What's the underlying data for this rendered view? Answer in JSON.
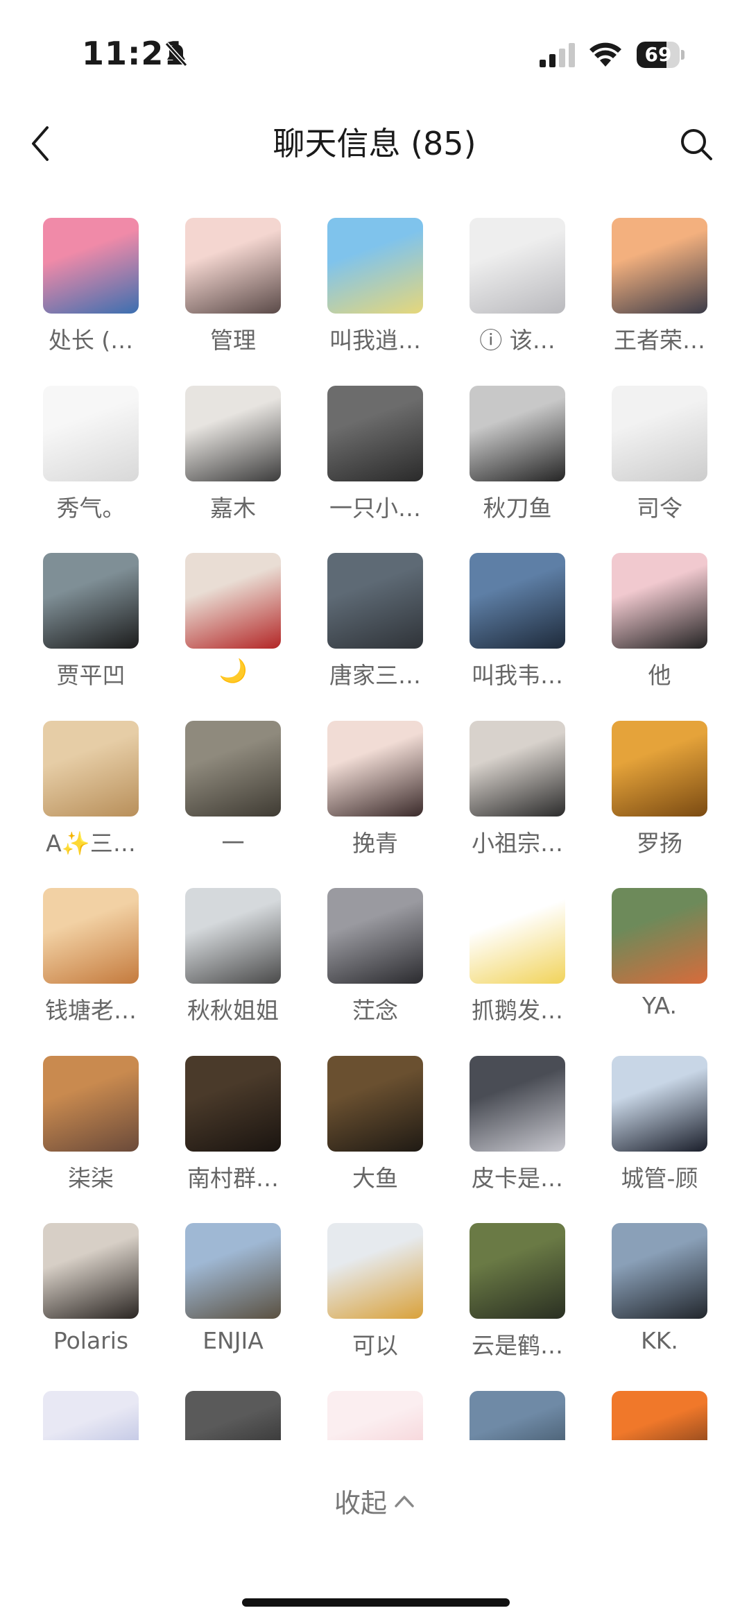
{
  "status_bar": {
    "time": "11:21",
    "battery": "69",
    "battery_level": 0.69
  },
  "header": {
    "title": "聊天信息 (85)"
  },
  "members": [
    {
      "name": "处长 (…",
      "colors": [
        "#f08aa8",
        "#3b6fb0"
      ]
    },
    {
      "name": "管理",
      "colors": [
        "#f4d6d0",
        "#5a4a48"
      ]
    },
    {
      "name": "叫我逍…",
      "colors": [
        "#7fc3ec",
        "#e6d77a"
      ]
    },
    {
      "name": "ⓘ 该…",
      "colors": [
        "#eeeeee",
        "#b9b9bd"
      ]
    },
    {
      "name": "王者荣…",
      "colors": [
        "#f3b07e",
        "#3b3b48"
      ]
    },
    {
      "name": "秀气。",
      "colors": [
        "#f7f7f7",
        "#d8d8d8"
      ]
    },
    {
      "name": "嘉木",
      "colors": [
        "#e7e4e0",
        "#3c3c3c"
      ]
    },
    {
      "name": "一只小…",
      "colors": [
        "#6c6c6c",
        "#2a2a2a"
      ]
    },
    {
      "name": "秋刀鱼",
      "colors": [
        "#c8c8c8",
        "#252525"
      ]
    },
    {
      "name": "司令",
      "colors": [
        "#f2f2f2",
        "#cccccc"
      ]
    },
    {
      "name": "贾平凹",
      "colors": [
        "#7f8f96",
        "#1c1c1c"
      ]
    },
    {
      "name": "🌙",
      "colors": [
        "#e9ddd4",
        "#b32626"
      ]
    },
    {
      "name": "唐家三…",
      "colors": [
        "#5e6a75",
        "#2f3338"
      ]
    },
    {
      "name": "叫我韦…",
      "colors": [
        "#5e7fa6",
        "#1e2a3a"
      ]
    },
    {
      "name": "他",
      "colors": [
        "#f1c9cf",
        "#222222"
      ]
    },
    {
      "name": "A✨三…",
      "colors": [
        "#e6cda6",
        "#b88f5a"
      ]
    },
    {
      "name": "一",
      "colors": [
        "#8f8a7d",
        "#3f3b33"
      ]
    },
    {
      "name": "挽青",
      "colors": [
        "#f1dcd5",
        "#3a2a2a"
      ]
    },
    {
      "name": "小祖宗…",
      "colors": [
        "#d8d2cc",
        "#2b2b2b"
      ]
    },
    {
      "name": "罗扬",
      "colors": [
        "#e5a33a",
        "#7a4a12"
      ]
    },
    {
      "name": "钱塘老…",
      "colors": [
        "#f2d1a4",
        "#c47a3d"
      ]
    },
    {
      "name": "秋秋姐姐",
      "colors": [
        "#d5d9dc",
        "#4a4a4a"
      ]
    },
    {
      "name": "茳念",
      "colors": [
        "#9a9aa0",
        "#2b2b2f"
      ]
    },
    {
      "name": "抓鹅发…",
      "colors": [
        "#ffffff",
        "#f1d35a"
      ]
    },
    {
      "name": "YA.",
      "colors": [
        "#6d8a5a",
        "#d86b3b"
      ]
    },
    {
      "name": "柒柒",
      "colors": [
        "#c98a4f",
        "#6a4a3a"
      ]
    },
    {
      "name": "南村群…",
      "colors": [
        "#4a3a2a",
        "#1a1410"
      ]
    },
    {
      "name": "大鱼",
      "colors": [
        "#6a5030",
        "#1f1a14"
      ]
    },
    {
      "name": "皮卡是…",
      "colors": [
        "#4a4d55",
        "#c9c9d0"
      ]
    },
    {
      "name": "城管-顾",
      "colors": [
        "#c8d6e6",
        "#1a1e2a"
      ]
    },
    {
      "name": "Polaris",
      "colors": [
        "#d7cfc6",
        "#2a2522"
      ]
    },
    {
      "name": "ENJIA",
      "colors": [
        "#9fb8d4",
        "#5a5040"
      ]
    },
    {
      "name": "可以",
      "colors": [
        "#e6eaee",
        "#d9a13a"
      ]
    },
    {
      "name": "云是鹤…",
      "colors": [
        "#6a7a45",
        "#2a2f22"
      ]
    },
    {
      "name": "KK.",
      "colors": [
        "#8aa0b8",
        "#22262c"
      ]
    },
    {
      "name": "",
      "colors": [
        "#e8e8f4",
        "#9ea8d6"
      ]
    },
    {
      "name": "",
      "colors": [
        "#5a5a5a",
        "#1a1a1a"
      ]
    },
    {
      "name": "",
      "colors": [
        "#fbeef0",
        "#f2c0c6"
      ]
    },
    {
      "name": "",
      "colors": [
        "#6f8aa6",
        "#2a3a46"
      ]
    },
    {
      "name": "",
      "colors": [
        "#f0782a",
        "#3a1e12"
      ]
    }
  ],
  "footer": {
    "collapse_label": "收起"
  }
}
